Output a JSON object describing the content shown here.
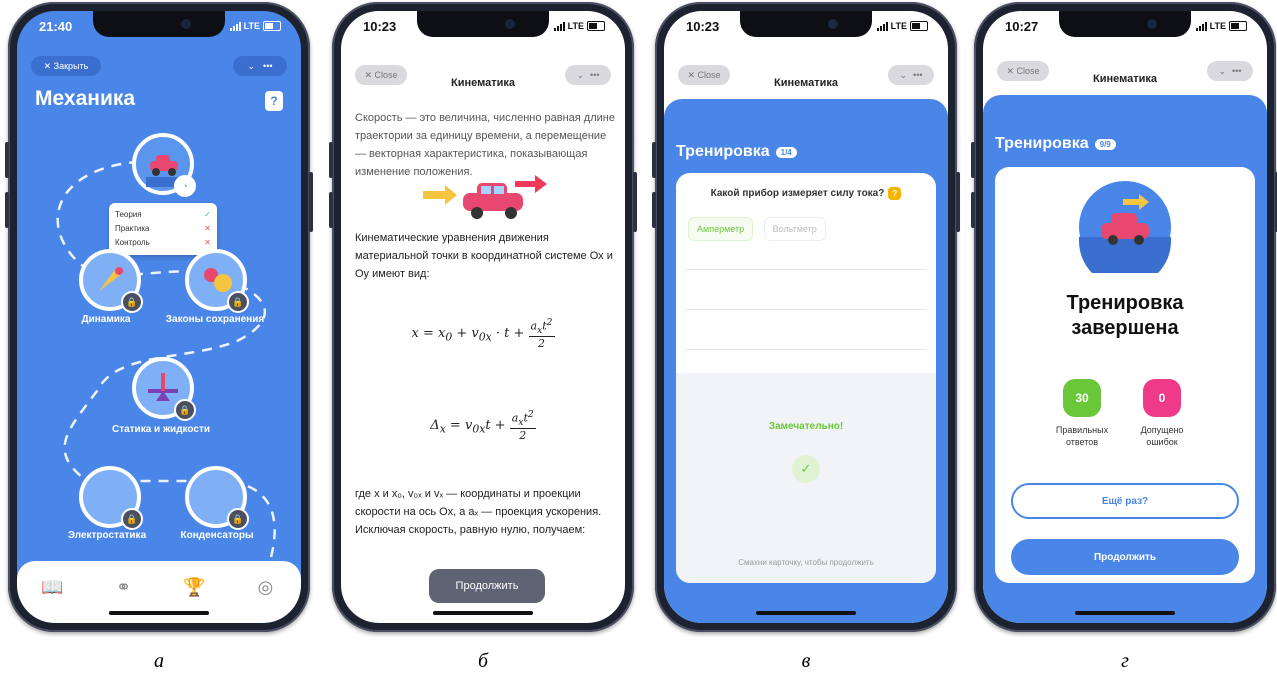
{
  "captions": [
    "а",
    "б",
    "в",
    "г"
  ],
  "phone_a": {
    "time": "21:40",
    "network": "LTE",
    "close_label": "✕ Закрыть",
    "title": "Механика",
    "popup": [
      {
        "label": "Теория",
        "mark": "✓"
      },
      {
        "label": "Практика",
        "mark": "✕"
      },
      {
        "label": "Контроль",
        "mark": "✕"
      }
    ],
    "nodes": [
      "Динамика",
      "Законы сохранения",
      "Статика и жидкости",
      "Электростатика",
      "Конденсаторы"
    ]
  },
  "phone_b": {
    "time": "10:23",
    "network": "LTE",
    "close_label": "✕ Close",
    "title": "Кинематика",
    "para1": "Скорость — это величина, численно равная длине траектории за единицу времени, а перемещение — векторная характеристика, показывающая изменение положения.",
    "para2": "Кинематические уравнения движения материальной точки в координатной системе Ох и Оу имеют вид:",
    "para3": "где x и x₀, v₀ₓ и vₓ — координаты и проекции скорости на ось Ох, а aₓ — проекция ускорения. Исключая скорость, равную нулю, получаем:",
    "continue_label": "Продолжить"
  },
  "phone_c": {
    "time": "10:23",
    "network": "LTE",
    "close_label": "✕ Close",
    "title": "Кинематика",
    "training_label": "Тренировка",
    "progress_badge": "1/4",
    "question": "Какой прибор измеряет силу тока?",
    "option_1": "Амперметр",
    "option_2": "Вольтметр",
    "feedback": "Замечательно!",
    "swipe_hint": "Смахни карточку, чтобы продолжить"
  },
  "phone_d": {
    "time": "10:27",
    "network": "LTE",
    "close_label": "✕ Close",
    "title": "Кинематика",
    "training_label": "Тренировка",
    "progress_badge": "9/9",
    "done_line1": "Тренировка",
    "done_line2": "завершена",
    "correct_count": "30",
    "correct_label": "Правильных ответов",
    "errors_count": "0",
    "errors_label": "Допущено ошибок",
    "retry_label": "Ещё раз?",
    "continue_label": "Продолжить"
  },
  "colors": {
    "primary_blue": "#4a86e8",
    "correct_green": "#6bc73a",
    "error_pink": "#ef3a8a"
  }
}
